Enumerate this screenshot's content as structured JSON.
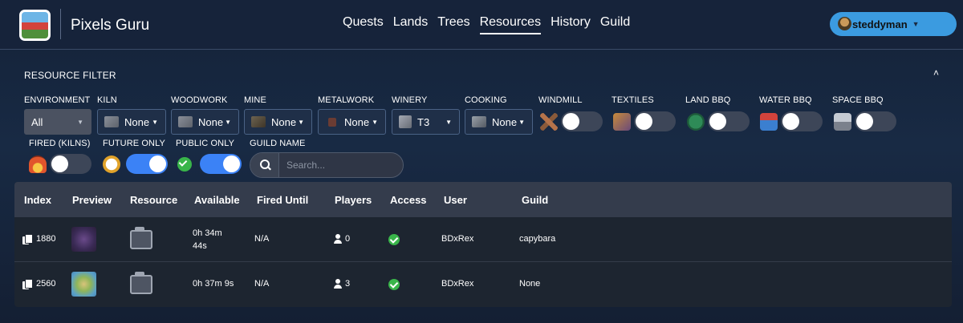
{
  "header": {
    "brand": "Pixels Guru",
    "nav": [
      "Quests",
      "Lands",
      "Trees",
      "Resources",
      "History",
      "Guild"
    ],
    "active_nav": "Resources",
    "user": "steddyman"
  },
  "filter": {
    "title": "RESOURCE FILTER",
    "collapse_glyph": "˄",
    "labels": {
      "environment": "ENVIRONMENT",
      "kiln": "KILN",
      "woodwork": "WOODWORK",
      "mine": "MINE",
      "metalwork": "METALWORK",
      "winery": "WINERY",
      "cooking": "COOKING",
      "windmill": "WINDMILL",
      "textiles": "TEXTILES",
      "land_bbq": "LAND BBQ",
      "water_bbq": "WATER BBQ",
      "space_bbq": "SPACE BBQ",
      "fired_kilns": "FIRED (KILNS)",
      "future_only": "FUTURE ONLY",
      "public_only": "PUBLIC ONLY",
      "guild_name": "GUILD NAME"
    },
    "values": {
      "environment": "All",
      "kiln": "None",
      "woodwork": "None",
      "mine": "None",
      "metalwork": "None",
      "winery": "T3",
      "cooking": "None"
    },
    "toggles": {
      "windmill": false,
      "textiles": false,
      "land_bbq": false,
      "water_bbq": false,
      "space_bbq": false,
      "fired_kilns": false,
      "future_only": true,
      "public_only": true
    },
    "search_placeholder": "Search...",
    "accent_color": "#3b82f6"
  },
  "table": {
    "headers": [
      "Index",
      "Preview",
      "Resource",
      "Available",
      "Fired Until",
      "Players",
      "Access",
      "User",
      "Guild"
    ],
    "rows": [
      {
        "index": "1880",
        "available_1": "0h 34m",
        "available_2": "44s",
        "fired_until": "N/A",
        "players": "0",
        "user": "BDxRex",
        "guild": "capybara"
      },
      {
        "index": "2560",
        "available_1": "0h 37m 9s",
        "available_2": "",
        "fired_until": "N/A",
        "players": "3",
        "user": "BDxRex",
        "guild": "None"
      }
    ]
  }
}
